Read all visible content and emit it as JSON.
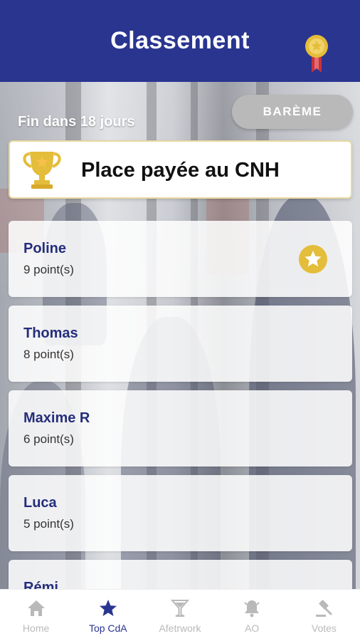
{
  "header": {
    "title": "Classement",
    "medal_icon": "medal-icon"
  },
  "toolbar": {
    "ends_text": "Fin dans 18 jours",
    "bareme_label": "BARÈME"
  },
  "prize": {
    "text": "Place payée au CNH",
    "icon": "trophy-icon"
  },
  "ranking": [
    {
      "name": "Poline",
      "points": "9 point(s)",
      "starred": true
    },
    {
      "name": "Thomas",
      "points": "8 point(s)",
      "starred": false
    },
    {
      "name": "Maxime R",
      "points": "6 point(s)",
      "starred": false
    },
    {
      "name": "Luca",
      "points": "5 point(s)",
      "starred": false
    },
    {
      "name": "Rémi",
      "points": "",
      "starred": false
    }
  ],
  "nav": {
    "items": [
      {
        "label": "Home",
        "icon": "home-icon",
        "active": false
      },
      {
        "label": "Top CdA",
        "icon": "star-icon",
        "active": true
      },
      {
        "label": "Afetrwork",
        "icon": "cocktail-icon",
        "active": false
      },
      {
        "label": "AO",
        "icon": "bell-icon",
        "active": false
      },
      {
        "label": "Votes",
        "icon": "gavel-icon",
        "active": false
      }
    ]
  },
  "colors": {
    "primary": "#2a3590",
    "gold": "#e4bd3a",
    "inactive": "#b9b9b9",
    "bareme_bg": "#b9b9b9"
  }
}
